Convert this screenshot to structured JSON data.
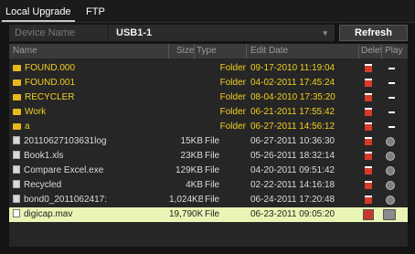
{
  "tabs": [
    {
      "label": "Local Upgrade",
      "active": true
    },
    {
      "label": "FTP",
      "active": false
    }
  ],
  "device": {
    "label": "Device Name",
    "value": "USB1-1",
    "refresh_label": "Refresh"
  },
  "table": {
    "columns": {
      "name": "Name",
      "size": "Size",
      "type": "Type",
      "edit_date": "Edit Date",
      "delete": "Delet",
      "play": "Play"
    },
    "rows": [
      {
        "name": "FOUND.000",
        "size": "",
        "type": "Folder",
        "date": "09-17-2010 11:19:04",
        "kind": "folder",
        "play": "dash"
      },
      {
        "name": "FOUND.001",
        "size": "",
        "type": "Folder",
        "date": "04-02-2011 17:45:24",
        "kind": "folder",
        "play": "dash"
      },
      {
        "name": "RECYCLER",
        "size": "",
        "type": "Folder",
        "date": "08-04-2010 17:35:20",
        "kind": "folder",
        "play": "dash"
      },
      {
        "name": "Work",
        "size": "",
        "type": "Folder",
        "date": "06-21-2011 17:55:42",
        "kind": "folder",
        "play": "dash"
      },
      {
        "name": "a",
        "size": "",
        "type": "Folder",
        "date": "06-27-2011 14:56:12",
        "kind": "folder",
        "play": "dash"
      },
      {
        "name": "20110627103631log",
        "size": "15KB",
        "type": "File",
        "date": "06-27-2011 10:36:30",
        "kind": "file",
        "play": "circle"
      },
      {
        "name": "Book1.xls",
        "size": "23KB",
        "type": "File",
        "date": "05-26-2011 18:32:14",
        "kind": "file",
        "play": "circle"
      },
      {
        "name": "Compare Excel.exe",
        "size": "129KB",
        "type": "File",
        "date": "04-20-2011 09:51:42",
        "kind": "file",
        "play": "circle"
      },
      {
        "name": "Recycled",
        "size": "4KB",
        "type": "File",
        "date": "02-22-2011 14:16:18",
        "kind": "file",
        "play": "circle"
      },
      {
        "name": "bond0_2011062417:",
        "size": "1,024KB",
        "type": "File",
        "date": "06-24-2011 17:20:48",
        "kind": "file",
        "play": "circle"
      },
      {
        "name": "digicap.mav",
        "size": "19,790KB",
        "type": "File",
        "date": "06-23-2011 09:05:20",
        "kind": "file",
        "play": "circle",
        "selected": true
      }
    ]
  },
  "colors": {
    "folder_text": "#f2cf1f",
    "selected_row": "#e9f5b4",
    "delete_icon": "#d83a2a"
  }
}
